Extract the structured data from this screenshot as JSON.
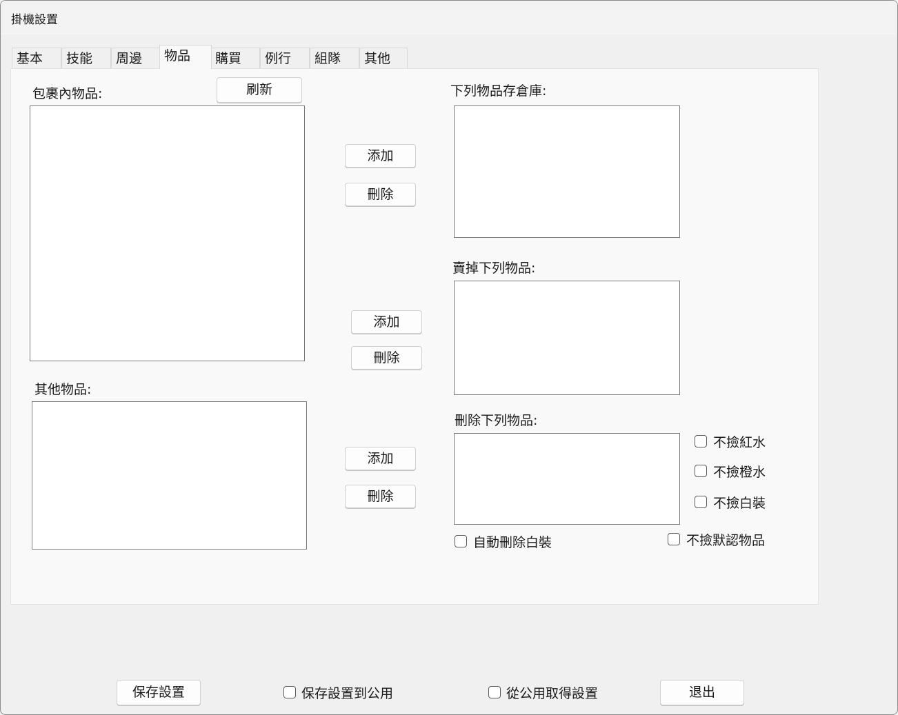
{
  "window": {
    "title": "掛機設置"
  },
  "tabs": [
    {
      "label": "基本"
    },
    {
      "label": "技能"
    },
    {
      "label": "周邊"
    },
    {
      "label": "物品"
    },
    {
      "label": "購買"
    },
    {
      "label": "例行"
    },
    {
      "label": "組隊"
    },
    {
      "label": "其他"
    }
  ],
  "active_tab": "物品",
  "items": {
    "bag_label": "包裹內物品:",
    "refresh_label": "刷新",
    "other_label": "其他物品:",
    "store_label": "下列物品存倉庫:",
    "sell_label": "賣掉下列物品:",
    "delete_label": "刪除下列物品:",
    "add_label": "添加",
    "remove_label": "刪除",
    "no_pick_red": "不撿紅水",
    "no_pick_orange": "不撿橙水",
    "no_pick_white": "不撿白裝",
    "auto_delete_white": "自動刪除白裝",
    "no_pick_default": "不撿默認物品"
  },
  "footer": {
    "save_label": "保存設置",
    "save_public_label": "保存設置到公用",
    "load_public_label": "從公用取得設置",
    "exit_label": "退出"
  }
}
